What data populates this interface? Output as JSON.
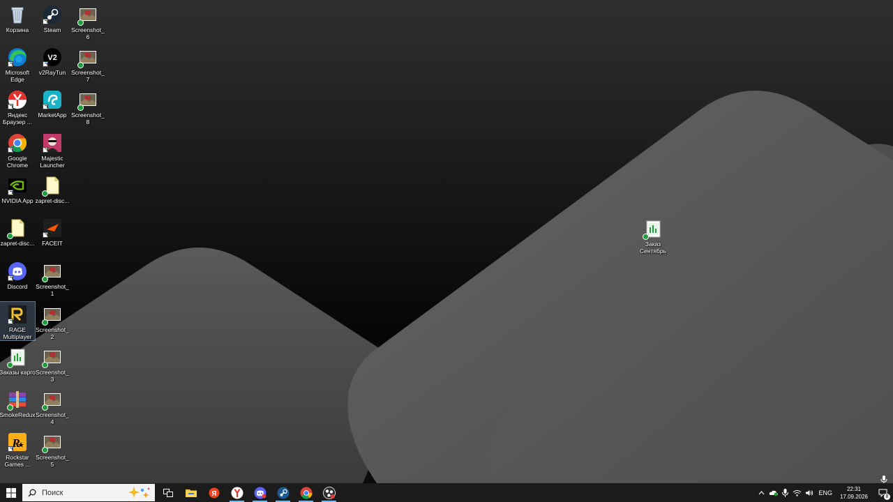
{
  "desktop": {
    "icons": [
      {
        "id": "recycle-bin",
        "label": "Корзина",
        "icon": "recycle-bin-icon"
      },
      {
        "id": "steam",
        "label": "Steam",
        "icon": "steam-icon"
      },
      {
        "id": "screenshot-6",
        "label": "Screenshot_6",
        "icon": "image-thumbnail-icon"
      },
      {
        "id": "edge",
        "label": "Microsoft Edge",
        "icon": "edge-icon"
      },
      {
        "id": "v2raytun",
        "label": "v2RayTun",
        "icon": "v2raytun-icon"
      },
      {
        "id": "screenshot-7",
        "label": "Screenshot_7",
        "icon": "image-thumbnail-icon"
      },
      {
        "id": "yandex",
        "label": "Яндекс Браузер ...",
        "icon": "yandex-browser-icon"
      },
      {
        "id": "marketapp",
        "label": "MarketApp",
        "icon": "marketapp-icon"
      },
      {
        "id": "screenshot-8",
        "label": "Screenshot_8",
        "icon": "image-thumbnail-icon"
      },
      {
        "id": "chrome",
        "label": "Google Chrome",
        "icon": "chrome-icon"
      },
      {
        "id": "majestic",
        "label": "Majestic Launcher",
        "icon": "majestic-launcher-icon"
      },
      {
        "id": "nvidia",
        "label": "NVIDIA App",
        "icon": "nvidia-icon"
      },
      {
        "id": "zapret-1",
        "label": "zapret-disc...",
        "icon": "file-icon"
      },
      {
        "id": "zapret-2",
        "label": "zapret-disc...",
        "icon": "file-icon"
      },
      {
        "id": "faceit",
        "label": "FACEIT",
        "icon": "faceit-icon"
      },
      {
        "id": "discord",
        "label": "Discord",
        "icon": "discord-icon"
      },
      {
        "id": "screenshot-1",
        "label": "Screenshot_1",
        "icon": "image-thumbnail-icon"
      },
      {
        "id": "rage",
        "label": "RAGE Multiplayer",
        "icon": "rage-mp-icon"
      },
      {
        "id": "screenshot-2",
        "label": "Screenshot_2",
        "icon": "image-thumbnail-icon"
      },
      {
        "id": "zakazy",
        "label": "Заказы карго",
        "icon": "spreadsheet-icon"
      },
      {
        "id": "screenshot-3",
        "label": "Screenshot_3",
        "icon": "image-thumbnail-icon"
      },
      {
        "id": "smokeredux",
        "label": "SmokeRedux",
        "icon": "archive-icon"
      },
      {
        "id": "screenshot-4",
        "label": "Screenshot_4",
        "icon": "image-thumbnail-icon"
      },
      {
        "id": "rockstar",
        "label": "Rockstar Games ...",
        "icon": "rockstar-icon"
      },
      {
        "id": "screenshot-5",
        "label": "Screenshot_5",
        "icon": "image-thumbnail-icon"
      },
      {
        "id": "zakaz-sentyabr",
        "label": "Заказ Сентябрь",
        "icon": "spreadsheet-icon"
      }
    ]
  },
  "taskbar": {
    "search_placeholder": "Поиск",
    "apps": [
      {
        "id": "task-view",
        "icon": "task-view-icon"
      },
      {
        "id": "explorer",
        "icon": "file-explorer-icon"
      },
      {
        "id": "yandex-tb",
        "icon": "yandex-icon"
      },
      {
        "id": "yandex-browser-tb",
        "icon": "yandex-browser-icon"
      },
      {
        "id": "discord-tb",
        "icon": "discord-icon"
      },
      {
        "id": "steam-tb",
        "icon": "steam-icon"
      },
      {
        "id": "chrome-tb",
        "icon": "chrome-icon"
      },
      {
        "id": "obs-tb",
        "icon": "obs-icon"
      }
    ],
    "tray": {
      "language": "ENG",
      "time": "22:31",
      "date": "17.09.2026",
      "notification_count": "8"
    }
  },
  "colors": {
    "taskbar_bg": "#1b1b1b",
    "selection": "#8caad2",
    "accent": "#76b9ed"
  }
}
